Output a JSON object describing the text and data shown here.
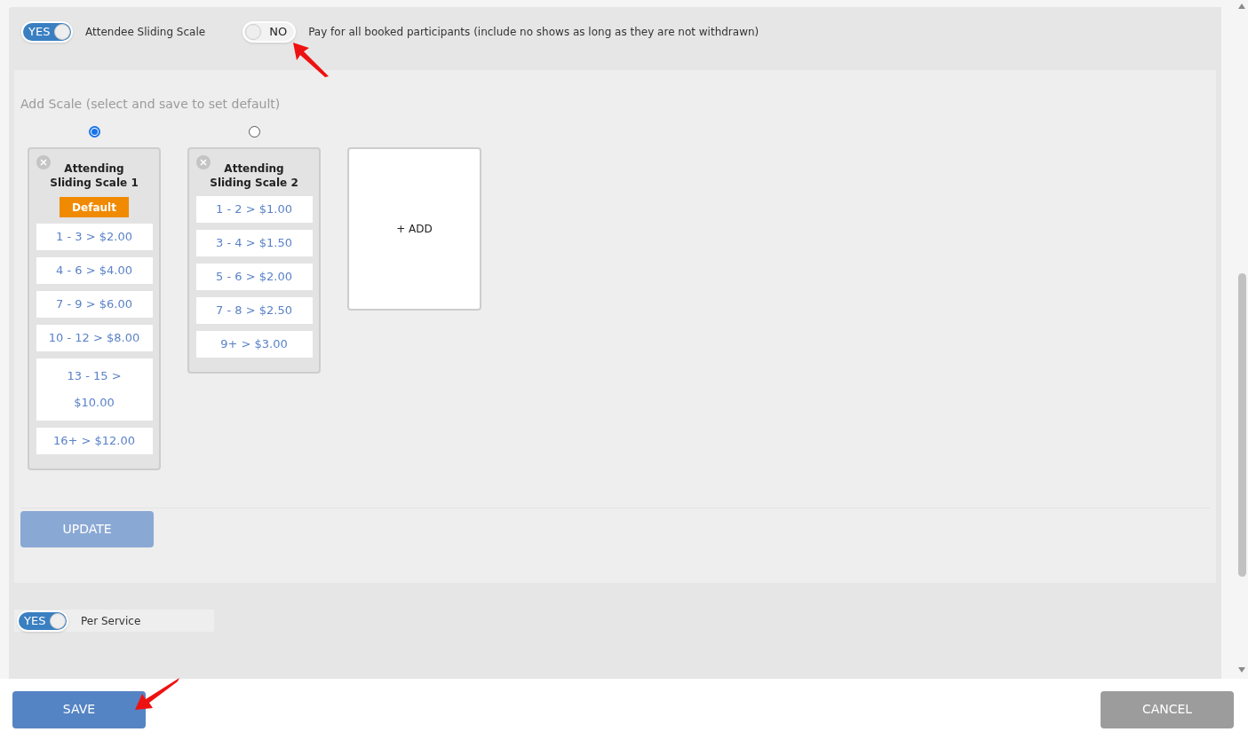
{
  "toggles_top": [
    {
      "on": true,
      "state_label": "YES",
      "label": "Attendee Sliding Scale"
    },
    {
      "on": false,
      "state_label": "NO",
      "label": "Pay for all booked participants (include no shows as long as they are not withdrawn)"
    }
  ],
  "scale_section": {
    "heading": "Add Scale (select and save to set default)",
    "scales": [
      {
        "selected": true,
        "title": "Attending Sliding Scale 1",
        "badge": "Default",
        "tiers": [
          "1 - 3 > $2.00",
          "4 - 6 > $4.00",
          "7 - 9 > $6.00",
          "10 - 12 > $8.00",
          "13 - 15 > $10.00",
          "16+ > $12.00"
        ]
      },
      {
        "selected": false,
        "title": "Attending Sliding Scale 2",
        "tiers": [
          "1 - 2 > $1.00",
          "3 - 4 > $1.50",
          "5 - 6 > $2.00",
          "7 - 8 > $2.50",
          "9+ > $3.00"
        ]
      }
    ],
    "add_label": "+ ADD",
    "update_button": "UPDATE"
  },
  "per_service": {
    "on": true,
    "state_label": "YES",
    "label": "Per Service"
  },
  "footer": {
    "save": "SAVE",
    "cancel": "CANCEL"
  }
}
